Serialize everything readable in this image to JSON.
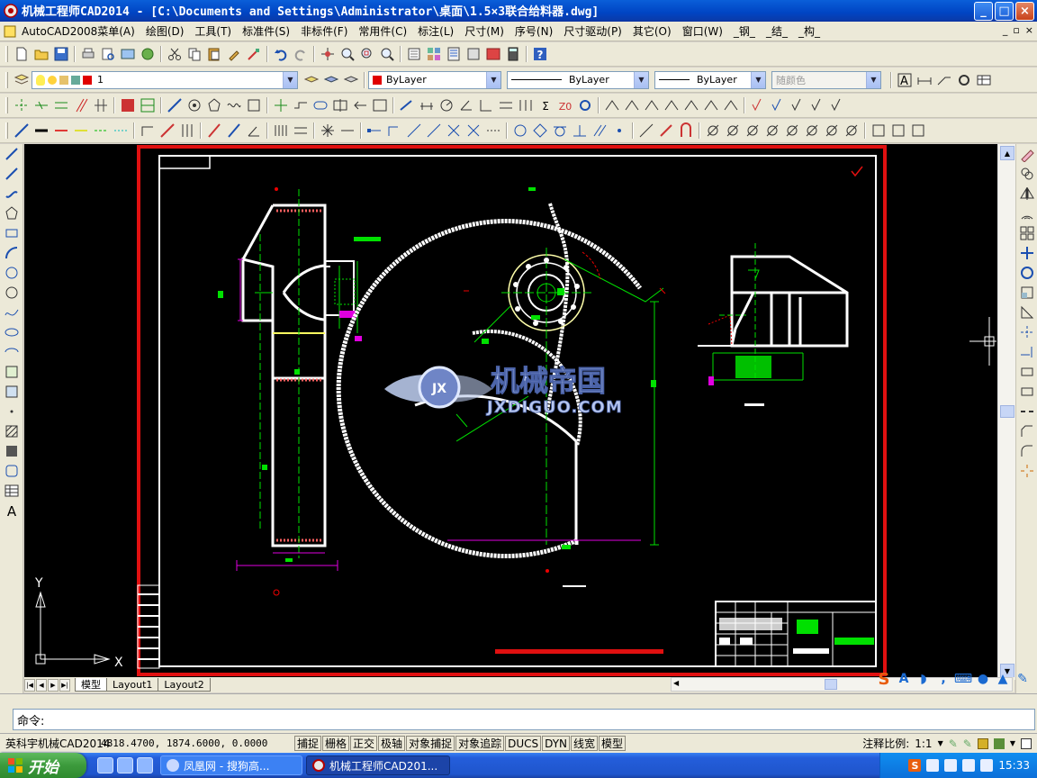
{
  "window": {
    "title": "机械工程师CAD2014 - [C:\\Documents and Settings\\Administrator\\桌面\\1.5×3联合给料器.dwg]",
    "buttons": {
      "minimize": "_",
      "maximize": "□",
      "close": "×"
    }
  },
  "menu": {
    "items": [
      "AutoCAD2008菜单(A)",
      "绘图(D)",
      "工具(T)",
      "标准件(S)",
      "非标件(F)",
      "常用件(C)",
      "标注(L)",
      "尺寸(M)",
      "序号(N)",
      "尺寸驱动(P)",
      "其它(O)",
      "窗口(W)",
      "_钢_",
      "_结_",
      "_构_"
    ],
    "doc_buttons": [
      "_",
      "▫",
      "×"
    ]
  },
  "layer_toolbar": {
    "layer_value": "1",
    "color_value": "ByLayer",
    "linetype_value": "ByLayer",
    "lineweight_value": "ByLayer",
    "plotstyle_value": "随颜色",
    "layer_color": "#ff0000"
  },
  "drawing": {
    "watermark_cn": "机械帝国",
    "watermark_en": "JXDIGUO.COM",
    "watermark_badge": "JX",
    "ucs_x": "X",
    "ucs_y": "Y"
  },
  "tabs": {
    "items": [
      "模型",
      "Layout1",
      "Layout2"
    ],
    "active": "模型"
  },
  "command": {
    "prompt": "命令:"
  },
  "status": {
    "app_name": "英科宇机械CAD2014",
    "coordinates": "4818.4700,  1874.6000,  0.0000",
    "toggles": [
      "捕捉",
      "栅格",
      "正交",
      "极轴",
      "对象捕捉",
      "对象追踪",
      "DUCS",
      "DYN",
      "线宽",
      "模型"
    ],
    "annotation_scale_label": "注释比例:",
    "annotation_scale_value": "1:1"
  },
  "taskbar": {
    "start_label": "开始",
    "tasks": [
      "凤凰网 - 搜狗高...",
      "机械工程师CAD201..."
    ],
    "clock": "15:33",
    "sogou_ime": "S"
  },
  "colors": {
    "titlebar": "#0a5fd9",
    "canvas": "#000000",
    "border_red": "#e01010",
    "frame_white": "#ffffff",
    "dim_green": "#00e000",
    "center_magenta": "#e000e0"
  }
}
